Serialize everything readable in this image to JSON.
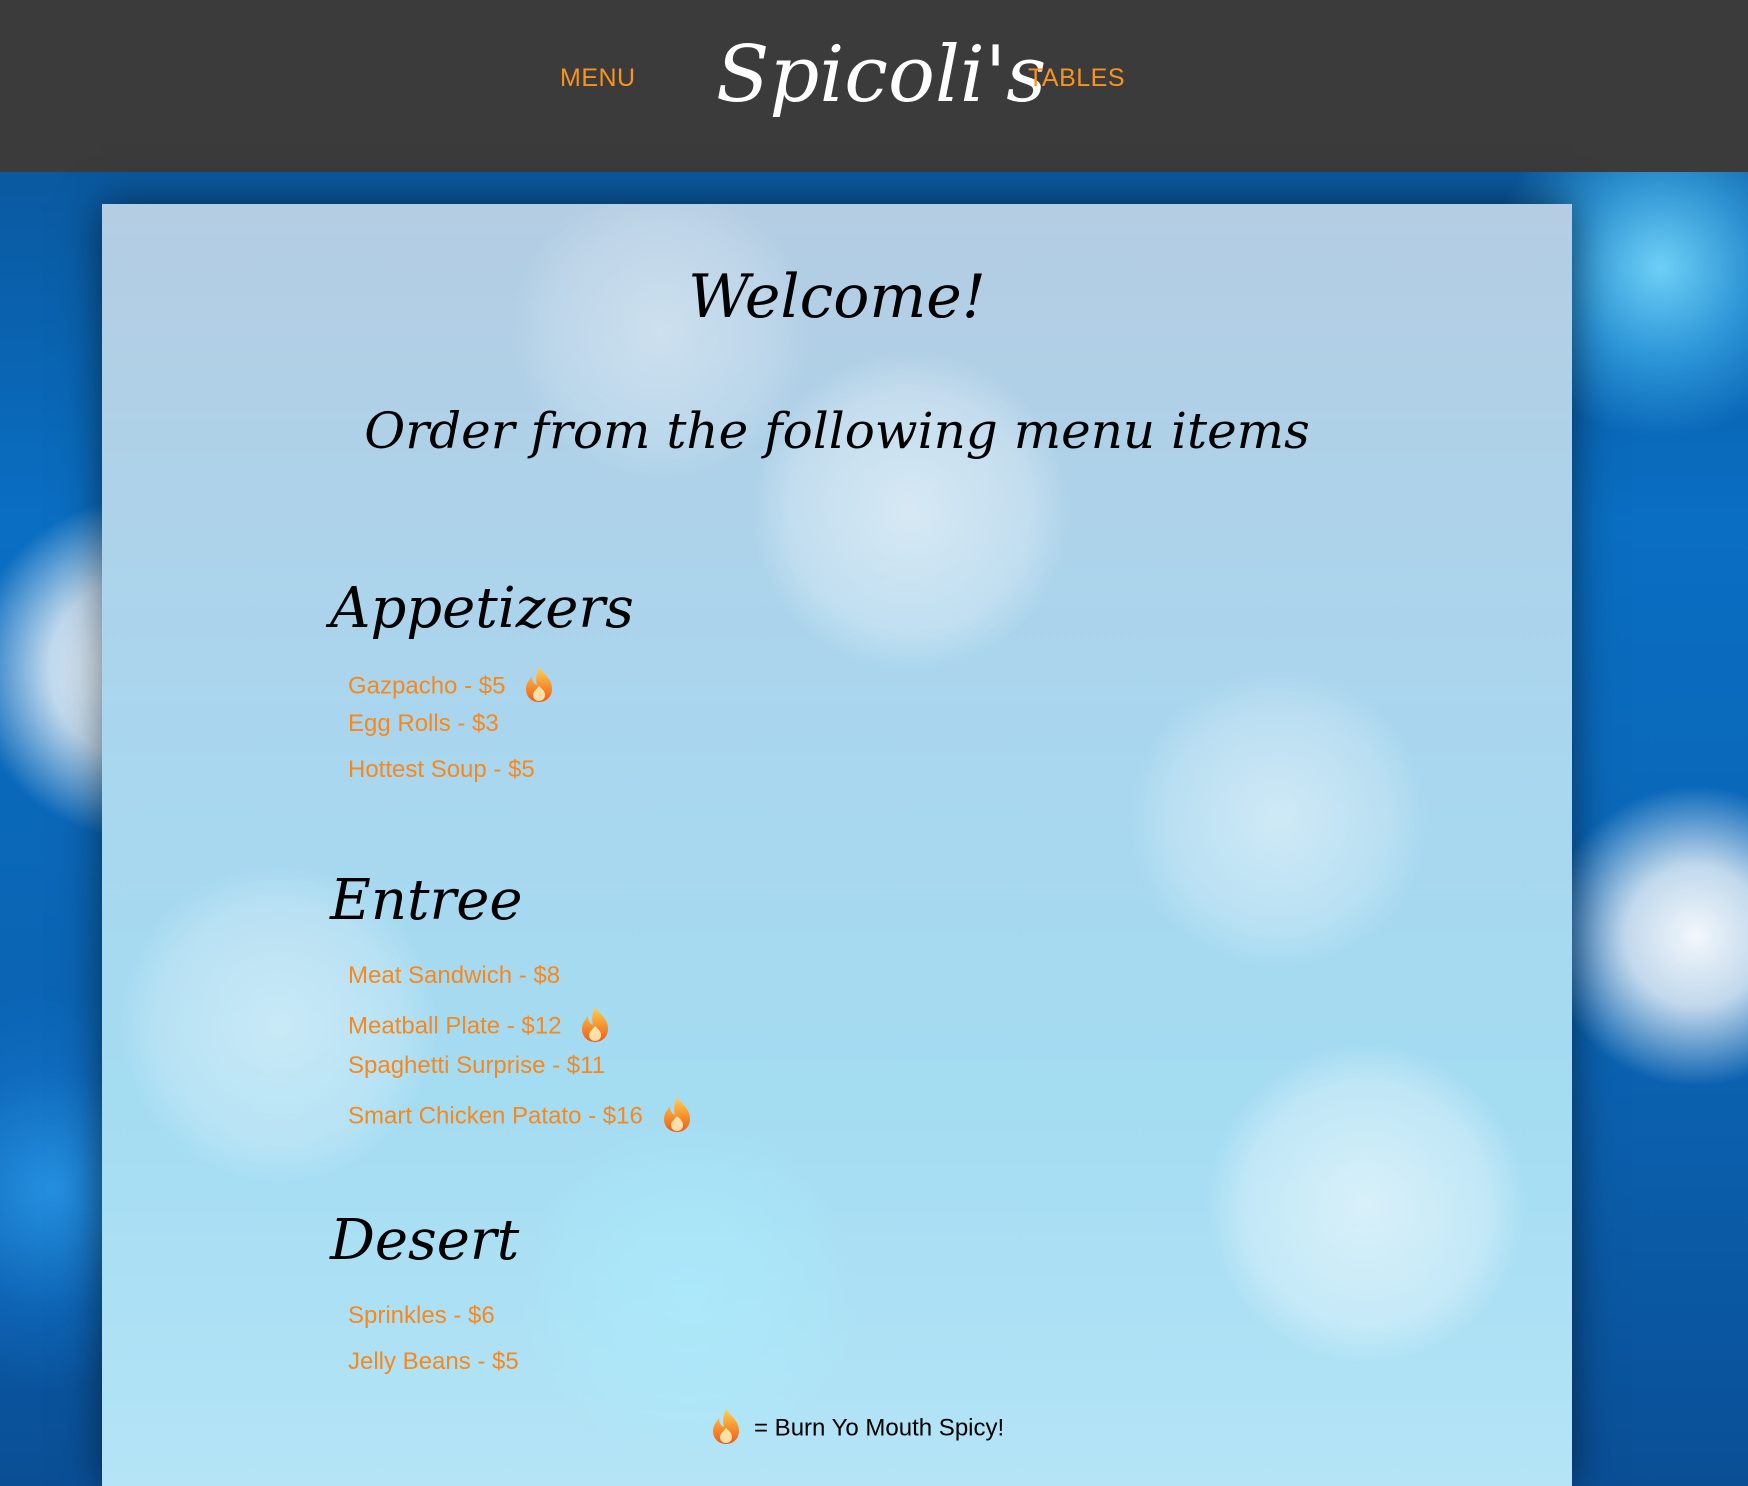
{
  "header": {
    "nav_left": "MENU",
    "logo": "Spicoli's",
    "nav_right": "TABLES",
    "accent_color": "#f7941d",
    "bar_color": "#3b3b3b"
  },
  "main": {
    "welcome": "Welcome!",
    "subtitle": "Order from the following menu items",
    "sections": [
      {
        "title": "Appetizers",
        "items": [
          {
            "label": "Gazpacho - $5",
            "spicy": true
          },
          {
            "label": "Egg Rolls - $3",
            "spicy": false
          },
          {
            "label": "Hottest Soup - $5",
            "spicy": false
          }
        ]
      },
      {
        "title": "Entree",
        "items": [
          {
            "label": "Meat Sandwich - $8",
            "spicy": false
          },
          {
            "label": "Meatball Plate - $12",
            "spicy": true
          },
          {
            "label": "Spaghetti Surprise - $11",
            "spicy": false
          },
          {
            "label": "Smart Chicken Patato - $16",
            "spicy": true
          }
        ]
      },
      {
        "title": "Desert",
        "items": [
          {
            "label": "Sprinkles - $6",
            "spicy": false
          },
          {
            "label": "Jelly Beans - $5",
            "spicy": false
          }
        ]
      }
    ],
    "legend": "= Burn Yo Mouth Spicy!",
    "spicy_icon": "flame-icon"
  }
}
